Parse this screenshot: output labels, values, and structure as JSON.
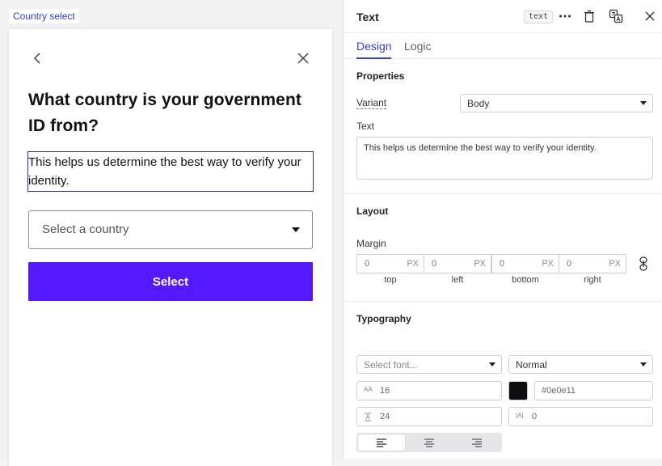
{
  "canvas": {
    "frame_label": "Country select",
    "card": {
      "headline": "What country is your government ID from?",
      "body": "This helps us determine the best way to verify your identity.",
      "country_placeholder": "Select a country",
      "select_label": "Select"
    },
    "accent": "#5519ff"
  },
  "panel": {
    "title": "Text",
    "type_badge": "text",
    "header_icons": [
      "more-icon",
      "trash-icon",
      "translate-icon",
      "close-icon"
    ],
    "tabs": [
      {
        "label": "Design",
        "active": true
      },
      {
        "label": "Logic",
        "active": false
      }
    ],
    "properties": {
      "title": "Properties",
      "variant_label": "Variant",
      "variant_value": "Body",
      "text_label": "Text",
      "text_value": "This helps us determine the best way to verify your identity."
    },
    "layout": {
      "title": "Layout",
      "margin_label": "Margin",
      "margins": [
        {
          "value": "0",
          "unit": "PX",
          "caption": "top"
        },
        {
          "value": "0",
          "unit": "PX",
          "caption": "left"
        },
        {
          "value": "0",
          "unit": "PX",
          "caption": "bottom"
        },
        {
          "value": "0",
          "unit": "PX",
          "caption": "right"
        }
      ]
    },
    "typography": {
      "title": "Typography",
      "font_placeholder": "Select font...",
      "weight_value": "Normal",
      "size_icon_text": "AA",
      "size_value": "16",
      "color_value": "#0e0e11",
      "line_height_value": "24",
      "letter_spacing_icon_text": "|A|",
      "letter_spacing_value": "0",
      "alignment": [
        "left",
        "center",
        "right"
      ],
      "active_alignment": "left"
    }
  }
}
